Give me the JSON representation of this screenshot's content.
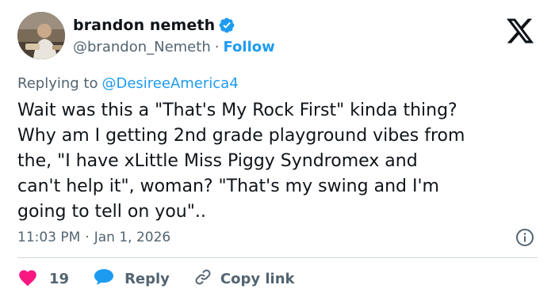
{
  "author": {
    "display_name": "brandon nemeth",
    "handle": "@brandon_Nemeth",
    "separator": "·",
    "follow_label": "Follow",
    "avatar_icon": "avatar",
    "verified_icon": "verified-badge-icon"
  },
  "brand": {
    "logo_icon": "x-logo-icon"
  },
  "reply_context": {
    "prefix": "Replying to",
    "mention": "@DesireeAmerica4"
  },
  "tweet": {
    "lines": [
      "Wait was this a \"That's My Rock First\" kinda thing?",
      "Why am I getting 2nd grade playground vibes from",
      "the, \"I have xLittle Miss Piggy Syndromex and",
      "can't help it\", woman? \"That's my swing and I'm",
      "going to tell on you\".."
    ]
  },
  "meta": {
    "time": "11:03 PM",
    "separator": "·",
    "date": "Jan 1, 2026",
    "info_icon": "info-icon"
  },
  "actions": {
    "like_count": "19",
    "reply_label": "Reply",
    "copy_link_label": "Copy link"
  },
  "colors": {
    "accent": "#1d9bf0",
    "like": "#f91880",
    "text": "#0f1419",
    "muted": "#536471",
    "divider": "#cfd9de"
  }
}
